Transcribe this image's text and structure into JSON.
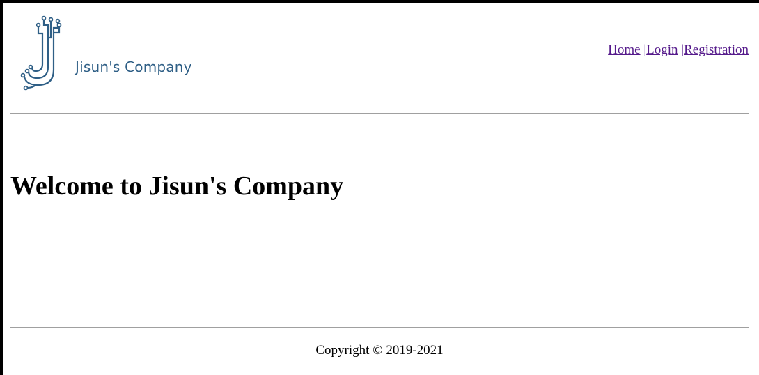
{
  "header": {
    "logo_text": "Jisun's Company",
    "logo_color": "#2f5f86",
    "nav": {
      "home": "Home",
      "separator": "|",
      "login": "Login",
      "registration": "Registration"
    },
    "link_color": "#551a8b"
  },
  "main": {
    "heading": "Welcome to Jisun's Company"
  },
  "footer": {
    "copyright": "Copyright © 2019-2021"
  }
}
